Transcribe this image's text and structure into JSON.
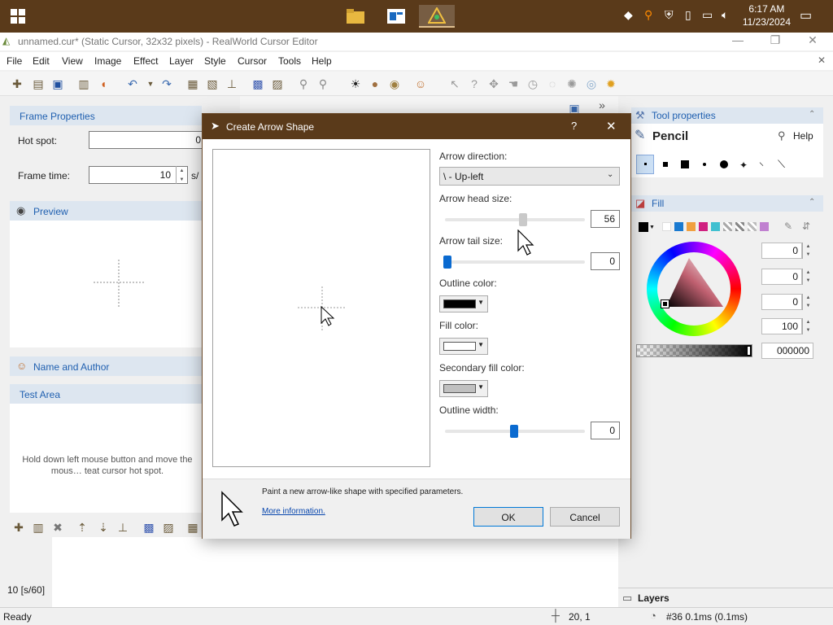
{
  "taskbar": {
    "time": "6:17 AM",
    "date": "11/23/2024"
  },
  "window": {
    "title": "unnamed.cur* (Static Cursor, 32x32 pixels) - RealWorld Cursor Editor"
  },
  "menubar": {
    "items": [
      "File",
      "Edit",
      "View",
      "Image",
      "Effect",
      "Layer",
      "Style",
      "Cursor",
      "Tools",
      "Help"
    ]
  },
  "left_panel": {
    "frame_properties_title": "Frame Properties",
    "hot_spot_label": "Hot spot:",
    "hot_spot_value": "0",
    "frame_time_label": "Frame time:",
    "frame_time_value": "10",
    "frame_time_unit": "s/",
    "preview_title": "Preview",
    "name_author_title": "Name and Author",
    "test_area_title": "Test Area",
    "test_area_hint": "Hold down left mouse button and move the mous… teat cursor hot spot."
  },
  "right_panel": {
    "tool_properties_title": "Tool properties",
    "tool_name": "Pencil",
    "help_label": "Help",
    "fill_title": "Fill",
    "rgb_values": [
      "0",
      "0",
      "0"
    ],
    "alpha_value": "100",
    "hex_value": "000000",
    "layers_title": "Layers"
  },
  "canvas": {
    "frame_label": "10 [s/60]"
  },
  "statusbar": {
    "status": "Ready",
    "coords": "20, 1",
    "frame_info": "#36 0.1ms (0.1ms)"
  },
  "dialog": {
    "title": "Create Arrow Shape",
    "help_glyph": "?",
    "close_glyph": "✕",
    "arrow_direction_label": "Arrow direction:",
    "arrow_direction_value": "\\ - Up-left",
    "arrow_head_size_label": "Arrow head size:",
    "arrow_head_size_value": "56",
    "arrow_head_size_level": 0.56,
    "arrow_tail_size_label": "Arrow tail size:",
    "arrow_tail_size_value": "0",
    "outline_color_label": "Outline color:",
    "outline_color": "#000000",
    "fill_color_label": "Fill color:",
    "fill_color": "#ffffff",
    "secondary_fill_color_label": "Secondary fill color:",
    "secondary_fill_color": "#c0c0c0",
    "outline_width_label": "Outline width:",
    "outline_width_value": "0",
    "description": "Paint a new arrow-like shape with specified parameters.",
    "more_info_link": "More information.",
    "ok_label": "OK",
    "cancel_label": "Cancel"
  },
  "colors": {
    "taskbar": "#5a3a1a",
    "accent_blue": "#2060b0",
    "slider_blue": "#0a6ad0"
  }
}
